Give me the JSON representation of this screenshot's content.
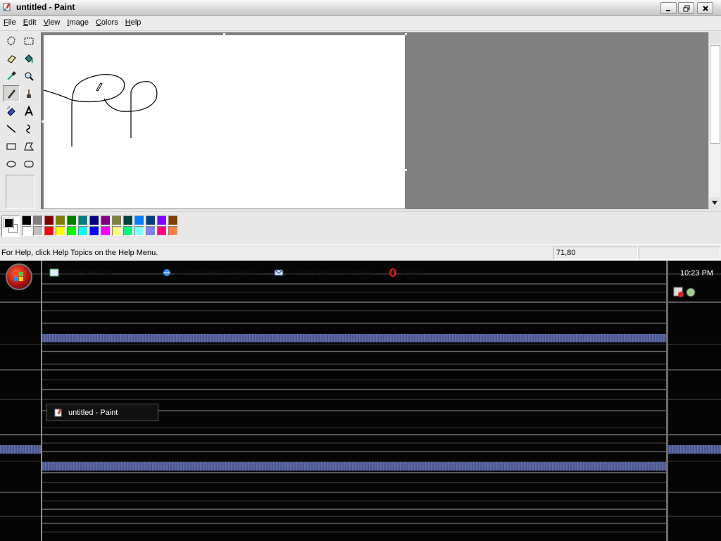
{
  "window": {
    "title": "untitled - Paint",
    "controls": {
      "minimize_icon": "minimize-icon",
      "restore_icon": "restore-icon",
      "close_icon": "close-icon"
    }
  },
  "menu": {
    "items": [
      {
        "label": "File",
        "mnemonic": "F",
        "rest": "ile"
      },
      {
        "label": "Edit",
        "mnemonic": "E",
        "rest": "dit"
      },
      {
        "label": "View",
        "mnemonic": "V",
        "rest": "iew"
      },
      {
        "label": "Image",
        "mnemonic": "I",
        "rest": "mage"
      },
      {
        "label": "Colors",
        "mnemonic": "C",
        "rest": "olors"
      },
      {
        "label": "Help",
        "mnemonic": "H",
        "rest": "elp"
      }
    ]
  },
  "toolbox": {
    "tools": [
      "free-form-select-icon",
      "select-icon",
      "eraser-icon",
      "fill-icon",
      "pick-color-icon",
      "magnifier-icon",
      "pencil-icon",
      "brush-icon",
      "airbrush-icon",
      "text-icon",
      "line-icon",
      "curve-icon",
      "rectangle-icon",
      "polygon-icon",
      "ellipse-icon",
      "rounded-rectangle-icon"
    ],
    "selected_tool": "pencil-icon"
  },
  "palette": {
    "foreground": "#000000",
    "background": "#ffffff",
    "row1": [
      "#000000",
      "#808080",
      "#800000",
      "#808000",
      "#008000",
      "#008080",
      "#000080",
      "#800080",
      "#808040",
      "#004040",
      "#0080ff",
      "#004080",
      "#8000ff",
      "#804000"
    ],
    "row2": [
      "#ffffff",
      "#c0c0c0",
      "#ff0000",
      "#ffff00",
      "#00ff00",
      "#00ffff",
      "#0000ff",
      "#ff00ff",
      "#ffff80",
      "#00ff80",
      "#80ffff",
      "#8080ff",
      "#ff0080",
      "#ff8040"
    ]
  },
  "status": {
    "help_text": "For Help, click Help Topics on the Help Menu.",
    "coordinates": "71,80",
    "size": ""
  },
  "taskbar": {
    "quick_launch": [
      {
        "label": "Show Desktop",
        "icon": "show-desktop-icon"
      },
      {
        "label": "Launch Internet Explorer",
        "icon": "internet-explorer-icon"
      },
      {
        "label": "Launch Outlook Express",
        "icon": "outlook-express-icon"
      },
      {
        "label": "Opera",
        "icon": "opera-icon"
      }
    ],
    "clock": "10:23 PM",
    "task_button_label": "untitled - Paint"
  }
}
